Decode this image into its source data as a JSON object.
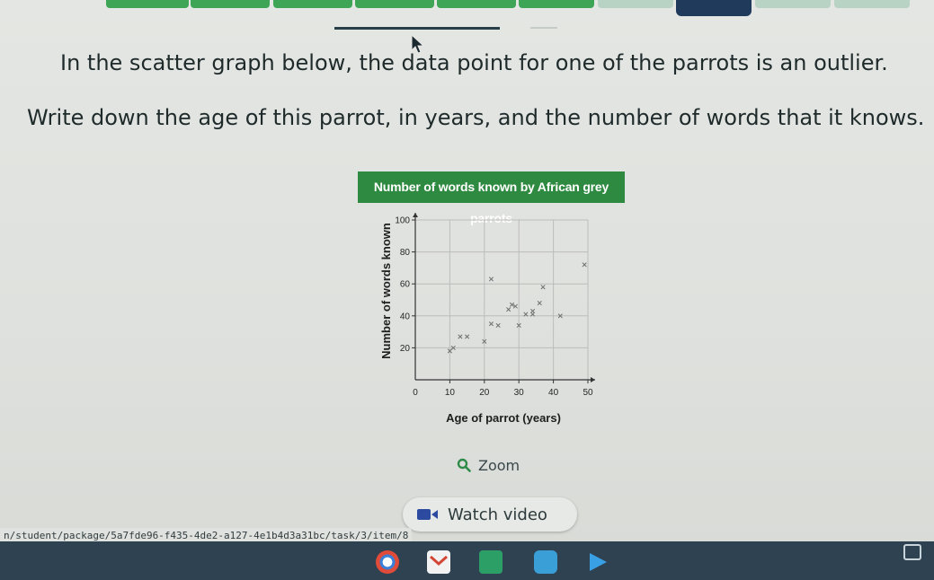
{
  "question": {
    "line1": "In the scatter graph below, the data point for one of the parrots is an outlier.",
    "line2": "Write down the age of this parrot, in years, and the number of words that it knows."
  },
  "chart_data": {
    "type": "scatter",
    "title": "Number of words known by African grey parrots",
    "xlabel": "Age of parrot (years)",
    "ylabel": "Number of words known",
    "xlim": [
      0,
      50
    ],
    "ylim": [
      0,
      100
    ],
    "xticks": [
      0,
      10,
      20,
      30,
      40,
      50
    ],
    "yticks": [
      20,
      40,
      60,
      80,
      100
    ],
    "grid": true,
    "series": [
      {
        "x": [
          10,
          11,
          13,
          15,
          20,
          22,
          22,
          24,
          27,
          28,
          29,
          30,
          32,
          34,
          34,
          36,
          37,
          42,
          49
        ],
        "y": [
          18,
          20,
          27,
          27,
          24,
          63,
          35,
          34,
          44,
          47,
          46,
          34,
          41,
          41,
          43,
          48,
          58,
          40,
          72
        ]
      }
    ]
  },
  "controls": {
    "zoom_label": "Zoom",
    "watch_label": "Watch video"
  },
  "status": {
    "url": "n/student/package/5a7fde96-f435-4de2-a127-4e1b4d3a31bc/task/3/item/8"
  },
  "colors": {
    "title_bg": "#2f8a41",
    "marker": "#6f6f6f",
    "taskbar": "#2e4252"
  },
  "icons": {
    "zoom": "magnifier-icon",
    "video": "video-camera-icon"
  }
}
